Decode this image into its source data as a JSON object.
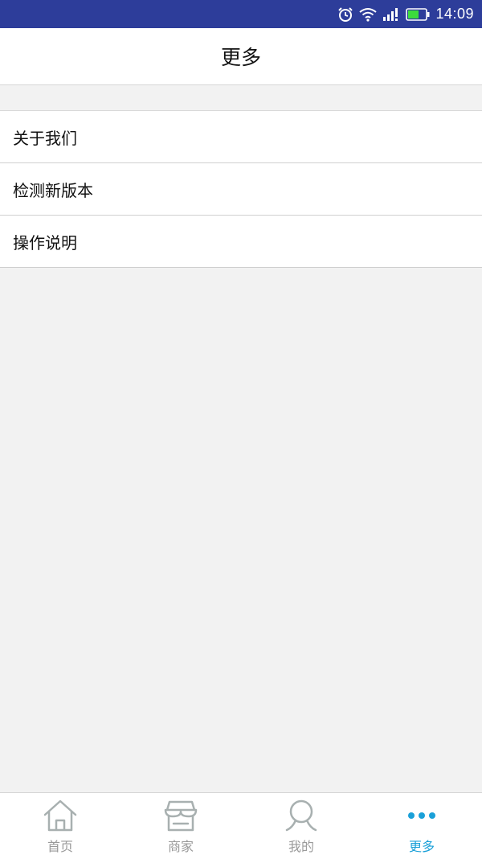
{
  "status_bar": {
    "time": "14:09",
    "icons": [
      "alarm-icon",
      "wifi-icon",
      "signal-icon",
      "battery-icon"
    ]
  },
  "header": {
    "title": "更多"
  },
  "menu": {
    "items": [
      {
        "label": "关于我们"
      },
      {
        "label": "检测新版本"
      },
      {
        "label": "操作说明"
      }
    ]
  },
  "tab_bar": {
    "active_color": "#1aa0d8",
    "inactive_color": "#9a9a9a",
    "tabs": [
      {
        "label": "首页",
        "icon": "home-icon"
      },
      {
        "label": "商家",
        "icon": "store-icon"
      },
      {
        "label": "我的",
        "icon": "user-icon"
      },
      {
        "label": "更多",
        "icon": "more-dots-icon",
        "active": true
      }
    ]
  }
}
